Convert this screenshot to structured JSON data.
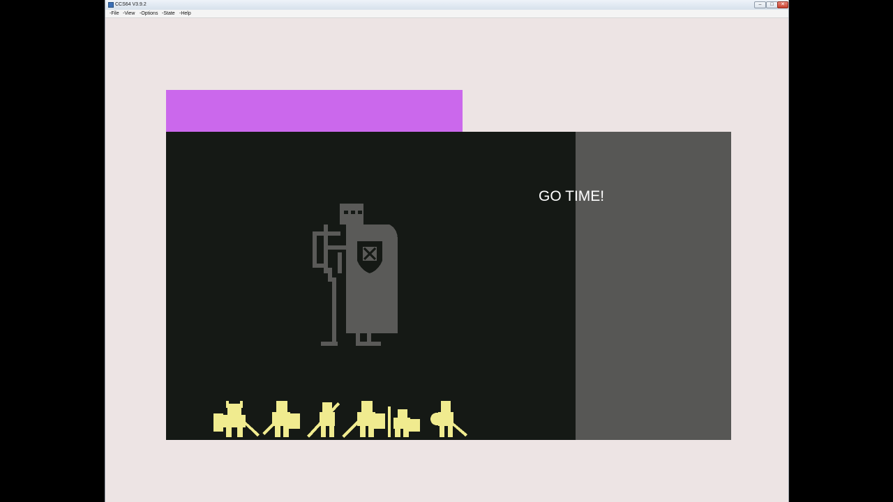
{
  "window": {
    "title": "CCS64 V3.9.2",
    "controls": {
      "minimize": "–",
      "maximize": "□",
      "close": "✕"
    }
  },
  "menu": {
    "items": [
      "-File",
      "-View",
      "-Options",
      "-State",
      "-Help"
    ]
  },
  "game": {
    "caption": "GO TIME!",
    "colors": {
      "top_bar": "#cb68ec",
      "playfield": "#151915",
      "side_panel": "#575755",
      "knight": "#5a5a58",
      "heroes": "#f0eb8f"
    },
    "party": [
      "barbarian",
      "knight",
      "spearman",
      "warrior",
      "dwarf",
      "elf"
    ]
  }
}
